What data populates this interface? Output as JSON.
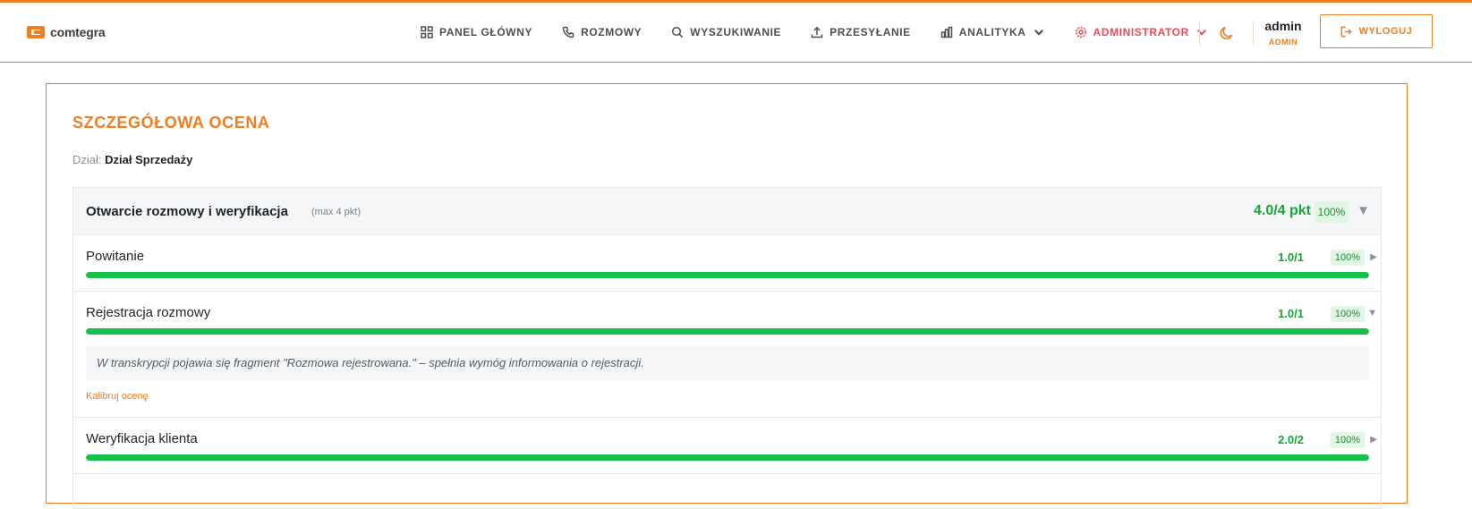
{
  "brand": {
    "name": "comtegra",
    "accent_color": "#ef7d22"
  },
  "nav": {
    "items": [
      {
        "label": "PANEL GŁÓWNY",
        "icon": "grid-icon"
      },
      {
        "label": "ROZMOWY",
        "icon": "phone-icon"
      },
      {
        "label": "WYSZUKIWANIE",
        "icon": "search-icon"
      },
      {
        "label": "PRZESYŁANIE",
        "icon": "upload-icon"
      },
      {
        "label": "ANALITYKA",
        "icon": "bar-chart-icon",
        "dropdown": true
      },
      {
        "label": "ADMINISTRATOR",
        "icon": "gear-icon",
        "dropdown": true,
        "color": "#ee4b55"
      }
    ]
  },
  "header": {
    "theme_icon": "moon-icon",
    "user": {
      "name": "admin",
      "role": "ADMIN"
    },
    "logout_label": "WYLOGUJ",
    "logout_icon": "logout-icon"
  },
  "evaluation": {
    "title": "SZCZEGÓŁOWA OCENA",
    "department_label": "Dział:",
    "department_value": "Dział Sprzedaży",
    "section": {
      "title": "Otwarcie rozmowy i weryfikacja",
      "max": "(max 4 pkt)",
      "score": "4.0/4 pkt",
      "percent": "100%",
      "expanded": true,
      "criteria": [
        {
          "label": "Powitanie",
          "score": "1.0/1",
          "percent": "100%",
          "progress": 1.0,
          "expanded": false
        },
        {
          "label": "Rejestracja rozmowy",
          "score": "1.0/1",
          "percent": "100%",
          "progress": 1.0,
          "expanded": true,
          "comment": "W transkrypcji pojawia się fragment \"Rozmowa rejestrowana.\" – spełnia wymóg informowania o rejestracji.",
          "calibrate_label": "Kalibruj ocenę"
        },
        {
          "label": "Weryfikacja klienta",
          "score": "2.0/2",
          "percent": "100%",
          "progress": 1.0,
          "expanded": false
        }
      ]
    }
  },
  "colors": {
    "success": "#16c04a",
    "success_text": "#1aa33a",
    "badge_bg": "#e3f6e6"
  }
}
